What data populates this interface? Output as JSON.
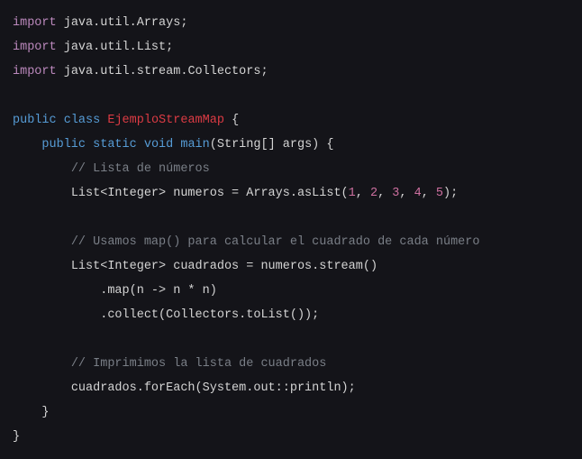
{
  "code": {
    "lines": [
      {
        "indent": 0,
        "tokens": [
          {
            "t": "import",
            "c": "kw"
          },
          {
            "t": " ",
            "c": "punct"
          },
          {
            "t": "java.util.Arrays",
            "c": "pkg"
          },
          {
            "t": ";",
            "c": "punct"
          }
        ]
      },
      {
        "indent": 0,
        "tokens": [
          {
            "t": "import",
            "c": "kw"
          },
          {
            "t": " ",
            "c": "punct"
          },
          {
            "t": "java.util.List",
            "c": "pkg"
          },
          {
            "t": ";",
            "c": "punct"
          }
        ]
      },
      {
        "indent": 0,
        "tokens": [
          {
            "t": "import",
            "c": "kw"
          },
          {
            "t": " ",
            "c": "punct"
          },
          {
            "t": "java.util.stream.Collectors",
            "c": "pkg"
          },
          {
            "t": ";",
            "c": "punct"
          }
        ]
      },
      {
        "indent": 0,
        "tokens": []
      },
      {
        "indent": 0,
        "tokens": [
          {
            "t": "public",
            "c": "kw-blue"
          },
          {
            "t": " ",
            "c": "punct"
          },
          {
            "t": "class",
            "c": "kw-blue"
          },
          {
            "t": " ",
            "c": "punct"
          },
          {
            "t": "EjemploStreamMap",
            "c": "classname"
          },
          {
            "t": " {",
            "c": "punct"
          }
        ]
      },
      {
        "indent": 1,
        "tokens": [
          {
            "t": "public",
            "c": "kw-blue"
          },
          {
            "t": " ",
            "c": "punct"
          },
          {
            "t": "static",
            "c": "kw-blue"
          },
          {
            "t": " ",
            "c": "punct"
          },
          {
            "t": "void",
            "c": "kw-blue"
          },
          {
            "t": " ",
            "c": "punct"
          },
          {
            "t": "main",
            "c": "method"
          },
          {
            "t": "(String[] args) {",
            "c": "punct"
          }
        ]
      },
      {
        "indent": 2,
        "tokens": [
          {
            "t": "// Lista de números",
            "c": "comment"
          }
        ]
      },
      {
        "indent": 2,
        "tokens": [
          {
            "t": "List<Integer> numeros = Arrays.asList(",
            "c": "punct"
          },
          {
            "t": "1",
            "c": "num"
          },
          {
            "t": ", ",
            "c": "punct"
          },
          {
            "t": "2",
            "c": "num"
          },
          {
            "t": ", ",
            "c": "punct"
          },
          {
            "t": "3",
            "c": "num"
          },
          {
            "t": ", ",
            "c": "punct"
          },
          {
            "t": "4",
            "c": "num"
          },
          {
            "t": ", ",
            "c": "punct"
          },
          {
            "t": "5",
            "c": "num"
          },
          {
            "t": ");",
            "c": "punct"
          }
        ]
      },
      {
        "indent": 0,
        "tokens": []
      },
      {
        "indent": 2,
        "tokens": [
          {
            "t": "// Usamos map() para calcular el cuadrado de cada número",
            "c": "comment"
          }
        ]
      },
      {
        "indent": 2,
        "tokens": [
          {
            "t": "List<Integer> cuadrados = numeros.stream()",
            "c": "punct"
          }
        ]
      },
      {
        "indent": 3,
        "tokens": [
          {
            "t": ".map(n -> n * n)",
            "c": "punct"
          }
        ]
      },
      {
        "indent": 3,
        "tokens": [
          {
            "t": ".collect(Collectors.toList());",
            "c": "punct"
          }
        ]
      },
      {
        "indent": 0,
        "tokens": []
      },
      {
        "indent": 2,
        "tokens": [
          {
            "t": "// Imprimimos la lista de cuadrados",
            "c": "comment"
          }
        ]
      },
      {
        "indent": 2,
        "tokens": [
          {
            "t": "cuadrados.forEach(System.out::println);",
            "c": "punct"
          }
        ]
      },
      {
        "indent": 1,
        "tokens": [
          {
            "t": "}",
            "c": "punct"
          }
        ]
      },
      {
        "indent": 0,
        "tokens": [
          {
            "t": "}",
            "c": "punct"
          }
        ]
      }
    ]
  }
}
